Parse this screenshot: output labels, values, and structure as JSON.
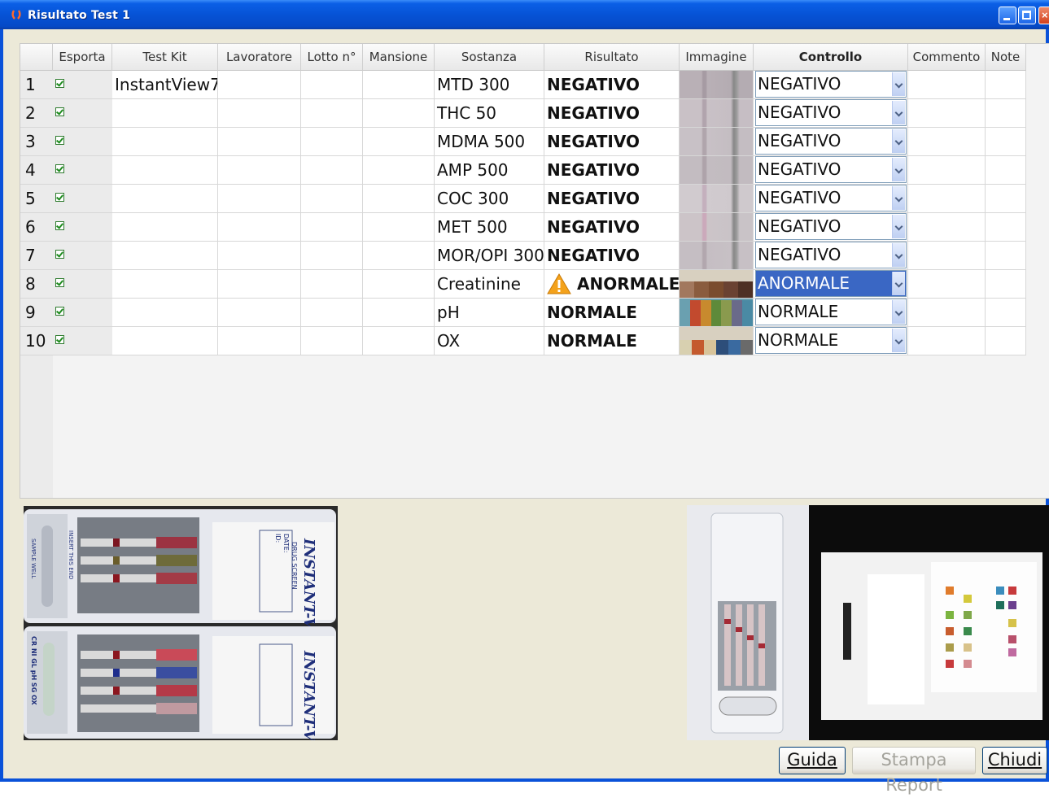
{
  "window": {
    "title": "Risultato Test 1"
  },
  "columns": [
    "Esporta",
    "Test Kit",
    "Lavoratore",
    "Lotto n°",
    "Mansione",
    "Sostanza",
    "Risultato",
    "Immagine",
    "Controllo",
    "Commento",
    "Note"
  ],
  "rows": [
    {
      "num": "1",
      "export": true,
      "kit": "InstantView7",
      "substance": "MTD 300",
      "result": "NEGATIVO",
      "warning": false,
      "control": "NEGATIVO",
      "image": "strip-mtd"
    },
    {
      "num": "2",
      "export": true,
      "kit": "",
      "substance": "THC 50",
      "result": "NEGATIVO",
      "warning": false,
      "control": "NEGATIVO",
      "image": "strip-thc"
    },
    {
      "num": "3",
      "export": true,
      "kit": "",
      "substance": "MDMA 500",
      "result": "NEGATIVO",
      "warning": false,
      "control": "NEGATIVO",
      "image": "strip-mdma"
    },
    {
      "num": "4",
      "export": true,
      "kit": "",
      "substance": "AMP 500",
      "result": "NEGATIVO",
      "warning": false,
      "control": "NEGATIVO",
      "image": "strip-amp"
    },
    {
      "num": "5",
      "export": true,
      "kit": "",
      "substance": "COC 300",
      "result": "NEGATIVO",
      "warning": false,
      "control": "NEGATIVO",
      "image": "strip-coc"
    },
    {
      "num": "6",
      "export": true,
      "kit": "",
      "substance": "MET 500",
      "result": "NEGATIVO",
      "warning": false,
      "control": "NEGATIVO",
      "image": "strip-met"
    },
    {
      "num": "7",
      "export": true,
      "kit": "",
      "substance": "MOR/OPI 300",
      "result": "NEGATIVO",
      "warning": false,
      "control": "NEGATIVO",
      "image": "strip-mor"
    },
    {
      "num": "8",
      "export": true,
      "kit": "",
      "substance": "Creatinine",
      "result": "ANORMALE",
      "warning": true,
      "control": "ANORMALE",
      "image": "color-pads-creatinine",
      "selected": true
    },
    {
      "num": "9",
      "export": true,
      "kit": "",
      "substance": "pH",
      "result": "NORMALE",
      "warning": false,
      "control": "NORMALE",
      "image": "color-pads-ph"
    },
    {
      "num": "10",
      "export": true,
      "kit": "",
      "substance": "OX",
      "result": "NORMALE",
      "warning": false,
      "control": "NORMALE",
      "image": "color-pads-ox"
    }
  ],
  "photos": {
    "left": {
      "brand": "INSTANT-VIEW",
      "subtitle": "DRUG SCREEN",
      "insert_label": "INSERT THIS END",
      "sample_well": "SAMPLE WELL",
      "date_label": "DATE:",
      "id_label": "ID:",
      "panel_letters": "CR NI GL pH SG OX"
    },
    "right": {
      "description": "cup-and-chart"
    }
  },
  "buttons": {
    "help": "Guida",
    "print": "Stampa Report",
    "close": "Chiudi"
  },
  "colors": {
    "selected_bg": "#3a67c4",
    "titlebar": "#0653d6",
    "warn": "#f4a21b"
  }
}
